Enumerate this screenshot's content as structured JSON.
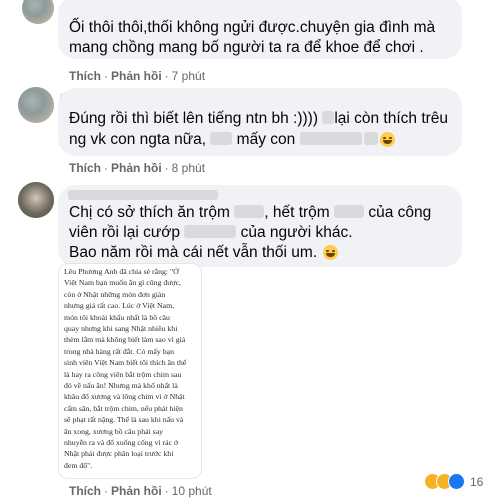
{
  "comments": [
    {
      "lines": [
        "Ối thôi thôi,thối không ngửi được.chuyện gia đình mà",
        "mang chồng mang bố người ta ra để khoe để chơi ."
      ],
      "like_label": "Thích",
      "reply_label": "Phản hồi",
      "time": "7 phút"
    },
    {
      "line1_a": "Đúng rồi thì biết lên tiếng ntn bh :)))) ",
      "line1_b": "lại còn thích trêu",
      "line2_a": "ng vk con ngta nữa, ",
      "line2_b": " mấy con",
      "like_label": "Thích",
      "reply_label": "Phản hồi",
      "time": "8 phút"
    },
    {
      "line1_a": "Chị có sở thích ăn trộm ",
      "line1_b": ", hết trộm ",
      "line1_c": " của công",
      "line2_a": "viên rồi lại cướp ",
      "line2_b": " của người khác.",
      "line3": "Bao năm rồi mà cái nết vẫn thối um.",
      "like_label": "Thích",
      "reply_label": "Phản hồi",
      "time": "10 phút"
    }
  ],
  "article_lines": [
    "Lêu Phương Anh đã chia sẻ rằng: \"Ở",
    "Việt Nam bạn muốn ăn gì cũng được,",
    "còn ở Nhật những món đơn giản",
    "nhưng giá rất cao. Lúc ở Việt Nam,",
    "món tôi khoái khẩu nhất là bồ câu",
    "quay nhưng khi sang Nhật nhiều khi",
    "thèm lắm mà không biết làm sao vì giá",
    "trong nhà hàng rất đắt. Có mấy bạn",
    "sinh viên Việt Nam biết tôi thích ăn thế",
    "là hay ra công viên bắt trộm chim sau",
    "đó về nấu ăn! Nhưng mà khổ nhất là",
    "khâu đổ xương và lông chim vì ở Nhật",
    "cấm săn, bắt trộm chim, nếu phát hiện",
    "sẽ phạt rất nặng. Thế là sau khi nấu và",
    "ăn xong, xương bồ câu phải say",
    "nhuyễn ra và đổ xuống cống vì rác ở",
    "Nhật phải được phân loại trước khi",
    "đem đổ\"."
  ],
  "reactions": {
    "count": "16",
    "icons": [
      "laugh-icon",
      "sad-icon",
      "like-icon"
    ]
  },
  "colors": {
    "bubble": "#f0f2f5",
    "meta": "#65676b",
    "text": "#050505",
    "like_blue": "#1877f2",
    "emoji": "#ffcc4d"
  }
}
